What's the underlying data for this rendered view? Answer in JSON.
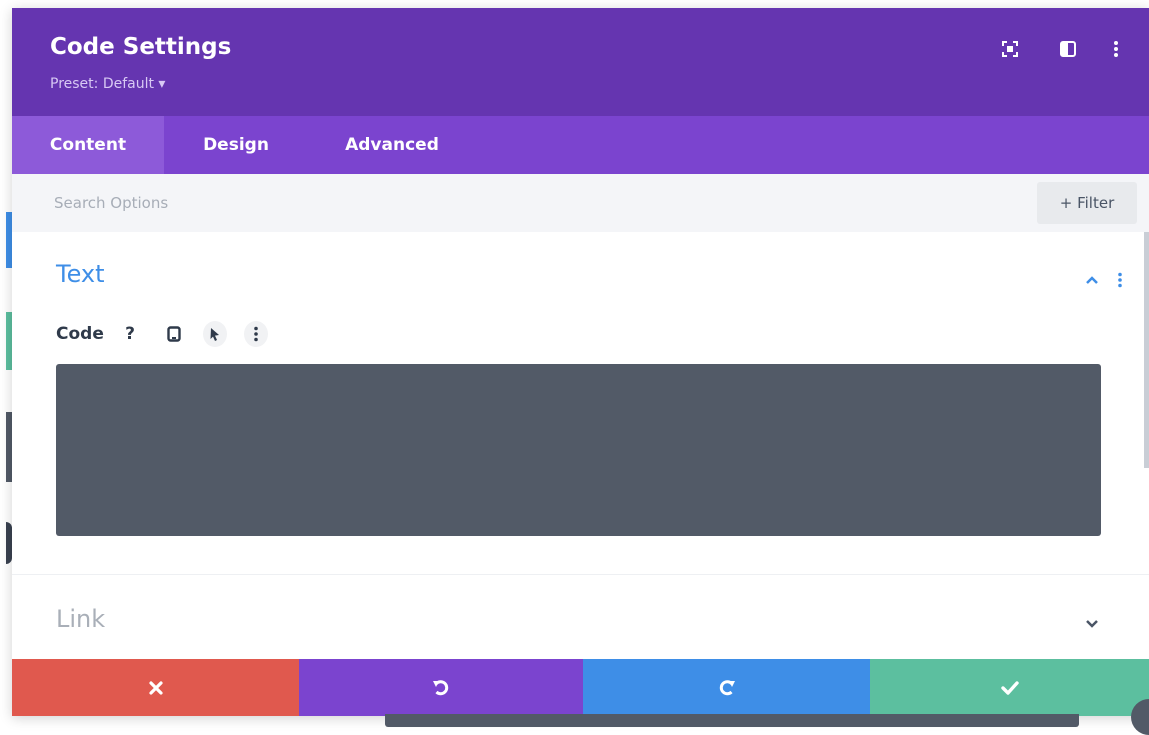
{
  "header": {
    "title": "Code Settings",
    "preset": "Preset: Default ▾"
  },
  "header_icons": [
    "fullscreen-icon",
    "split-view-icon",
    "more-options-icon"
  ],
  "tabs": [
    {
      "label": "Content",
      "active": true
    },
    {
      "label": "Design",
      "active": false
    },
    {
      "label": "Advanced",
      "active": false
    }
  ],
  "search": {
    "placeholder": "Search Options",
    "value": "",
    "filter_label": "+ Filter"
  },
  "sections": {
    "text": {
      "title": "Text",
      "expanded": true,
      "field": {
        "label": "Code",
        "help_glyph": "?",
        "value": ""
      }
    },
    "link": {
      "title": "Link",
      "expanded": false
    }
  },
  "footer": {
    "cancel_color": "#e0594e",
    "undo_color": "#7b44cf",
    "redo_color": "#3e8ee7",
    "save_color": "#5cbf9f"
  },
  "colors": {
    "header": "#6535b0",
    "tabs": "#7b44cf",
    "accent": "#3e8ee7",
    "code_bg": "#525a67"
  }
}
